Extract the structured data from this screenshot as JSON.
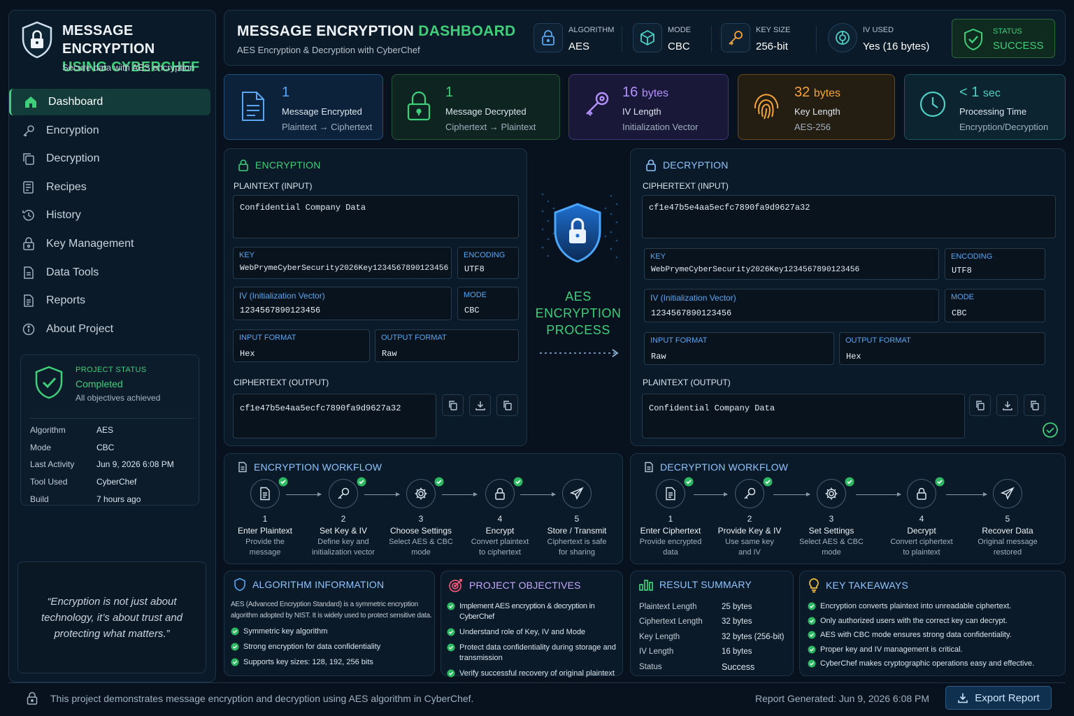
{
  "sidebar": {
    "title_line1": "MESSAGE ENCRYPTION",
    "title_line2": "USING CYBERCHEF",
    "subtitle": "Secure data with AES encryption",
    "nav": [
      {
        "label": "Dashboard",
        "icon": "home-icon",
        "active": true
      },
      {
        "label": "Encryption",
        "icon": "key-icon"
      },
      {
        "label": "Decryption",
        "icon": "copy-icon"
      },
      {
        "label": "Recipes",
        "icon": "recipes-icon"
      },
      {
        "label": "History",
        "icon": "history-icon"
      },
      {
        "label": "Key Management",
        "icon": "key-management-icon"
      },
      {
        "label": "Data Tools",
        "icon": "data-tools-icon"
      },
      {
        "label": "Reports",
        "icon": "reports-icon"
      },
      {
        "label": "About Project",
        "icon": "info-icon"
      }
    ],
    "status": {
      "label": "PROJECT STATUS",
      "value": "Completed",
      "note": "All objectives achieved",
      "rows": [
        {
          "k": "Algorithm",
          "v": "AES"
        },
        {
          "k": "Mode",
          "v": "CBC"
        },
        {
          "k": "Last Activity",
          "v": "Jun 9, 2026 6:08 PM"
        },
        {
          "k": "Tool Used",
          "v": "CyberChef"
        },
        {
          "k": "Build",
          "v": "7 hours ago"
        }
      ]
    },
    "quote": "“Encryption is not just about technology, it’s about trust and protecting what matters.”"
  },
  "header": {
    "title_main": "MESSAGE ENCRYPTION",
    "title_accent": "DASHBOARD",
    "subtitle": "AES Encryption & Decryption with CyberChef",
    "stats": [
      {
        "label": "ALGORITHM",
        "value": "AES"
      },
      {
        "label": "MODE",
        "value": "CBC"
      },
      {
        "label": "KEY SIZE",
        "value": "256-bit"
      },
      {
        "label": "IV USED",
        "value": "Yes (16 bytes)"
      }
    ],
    "status_label": "STATUS",
    "status_value": "SUCCESS"
  },
  "metrics": [
    {
      "value": "1",
      "unit": "",
      "label": "Message Encrypted",
      "sub": "Plaintext → Ciphertext"
    },
    {
      "value": "1",
      "unit": "",
      "label": "Message Decrypted",
      "sub": "Ciphertext → Plaintext"
    },
    {
      "value": "16",
      "unit": "bytes",
      "label": "IV Length",
      "sub": "Initialization Vector"
    },
    {
      "value": "32",
      "unit": "bytes",
      "label": "Key Length",
      "sub": "AES-256"
    },
    {
      "value": "< 1",
      "unit": "sec",
      "label": "Processing Time",
      "sub": "Encryption/Decryption"
    }
  ],
  "encryption": {
    "title": "ENCRYPTION",
    "input_label": "PLAINTEXT (INPUT)",
    "input_value": "Confidential Company Data",
    "key_label": "KEY",
    "key_value": "WebPrymeCyberSecurity2026Key1234567890123456",
    "encoding_label": "ENCODING",
    "encoding_value": "UTF8",
    "iv_label": "IV (Initialization Vector)",
    "iv_value": "1234567890123456",
    "mode_label": "MODE",
    "mode_value": "CBC",
    "in_format_label": "INPUT FORMAT",
    "in_format_value": "Hex",
    "out_format_label": "OUTPUT FORMAT",
    "out_format_value": "Raw",
    "output_label": "CIPHERTEXT (OUTPUT)",
    "output_value": "cf1e47b5e4aa5ecfc7890fa9d9627a32"
  },
  "center": {
    "line1": "AES",
    "line2": "ENCRYPTION",
    "line3": "PROCESS"
  },
  "decryption": {
    "title": "DECRYPTION",
    "input_label": "CIPHERTEXT (INPUT)",
    "input_value": "cf1e47b5e4aa5ecfc7890fa9d9627a32",
    "key_label": "KEY",
    "key_value": "WebPrymeCyberSecurity2026Key1234567890123456",
    "encoding_label": "ENCODING",
    "encoding_value": "UTF8",
    "iv_label": "IV (Initialization Vector)",
    "iv_value": "1234567890123456",
    "mode_label": "MODE",
    "mode_value": "CBC",
    "in_format_label": "INPUT FORMAT",
    "in_format_value": "Raw",
    "out_format_label": "OUTPUT FORMAT",
    "out_format_value": "Hex",
    "output_label": "PLAINTEXT (OUTPUT)",
    "output_value": "Confidential Company Data"
  },
  "enc_workflow": {
    "title": "ENCRYPTION WORKFLOW",
    "steps": [
      {
        "num": "1",
        "name": "Enter Plaintext",
        "desc1": "Provide the",
        "desc2": "message"
      },
      {
        "num": "2",
        "name": "Set Key & IV",
        "desc1": "Define key and",
        "desc2": "initialization vector"
      },
      {
        "num": "3",
        "name": "Choose Settings",
        "desc1": "Select AES & CBC",
        "desc2": "mode"
      },
      {
        "num": "4",
        "name": "Encrypt",
        "desc1": "Convert plaintext",
        "desc2": "to ciphertext"
      },
      {
        "num": "5",
        "name": "Store / Transmit",
        "desc1": "Ciphertext is safe",
        "desc2": "for sharing"
      }
    ]
  },
  "dec_workflow": {
    "title": "DECRYPTION WORKFLOW",
    "steps": [
      {
        "num": "1",
        "name": "Enter Ciphertext",
        "desc1": "Provide encrypted",
        "desc2": "data"
      },
      {
        "num": "2",
        "name": "Provide Key & IV",
        "desc1": "Use same key",
        "desc2": "and IV"
      },
      {
        "num": "3",
        "name": "Set Settings",
        "desc1": "Select AES & CBC",
        "desc2": "mode"
      },
      {
        "num": "4",
        "name": "Decrypt",
        "desc1": "Convert ciphertext",
        "desc2": "to plaintext"
      },
      {
        "num": "5",
        "name": "Recover Data",
        "desc1": "Original message",
        "desc2": "restored"
      }
    ]
  },
  "algorithm_info": {
    "title": "ALGORITHM INFORMATION",
    "desc": "AES (Advanced Encryption Standard) is a symmetric encryption algorithm adopted by NIST. It is widely used to protect sensitive data.",
    "points": [
      "Symmetric key algorithm",
      "Strong encryption for data confidentiality",
      "Supports key sizes: 128, 192, 256 bits"
    ]
  },
  "objectives": {
    "title": "PROJECT OBJECTIVES",
    "points": [
      "Implement AES encryption & decryption in CyberChef",
      "Understand role of Key, IV and Mode",
      "Protect data confidentiality during storage and transmission",
      "Verify successful recovery of original plaintext"
    ]
  },
  "result_summary": {
    "title": "RESULT SUMMARY",
    "rows": [
      {
        "k": "Plaintext Length",
        "v": "25 bytes"
      },
      {
        "k": "Ciphertext Length",
        "v": "32 bytes"
      },
      {
        "k": "Key Length",
        "v": "32 bytes (256-bit)"
      },
      {
        "k": "IV Length",
        "v": "16 bytes"
      },
      {
        "k": "Status",
        "v": "Success"
      }
    ]
  },
  "takeaways": {
    "title": "KEY TAKEAWAYS",
    "points": [
      "Encryption converts plaintext into unreadable ciphertext.",
      "Only authorized users with the correct key can decrypt.",
      "AES with CBC mode ensures strong data confidentiality.",
      "Proper key and IV management is critical.",
      "CyberChef makes cryptographic operations easy and effective."
    ]
  },
  "footer": {
    "note": "This project demonstrates message encryption and decryption using AES algorithm in CyberChef.",
    "generated": "Report Generated: Jun 9, 2026 6:08 PM",
    "export_label": "Export Report"
  },
  "colors": {
    "accent_green": "#3fcf7a",
    "accent_blue": "#5aa6f0",
    "accent_purple": "#b392ff",
    "accent_orange": "#f6a53a",
    "accent_teal": "#4ed1c5",
    "background": "#07121e"
  }
}
